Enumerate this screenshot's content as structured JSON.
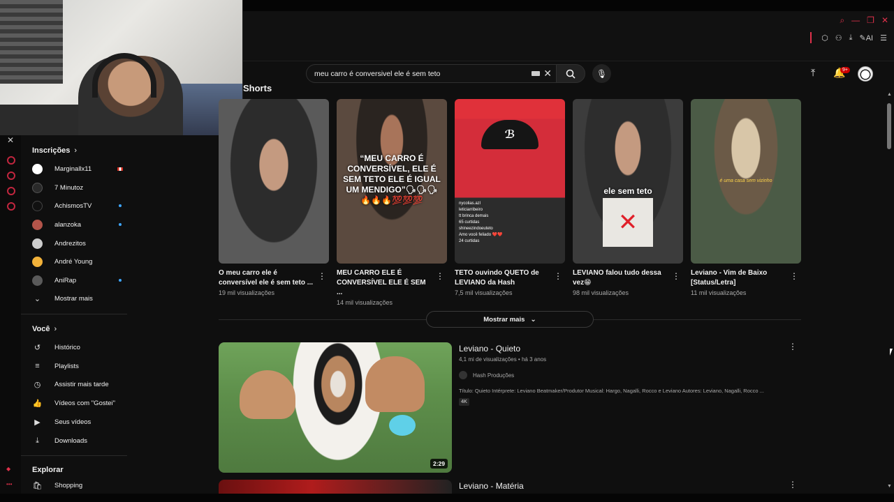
{
  "search": {
    "query": "meu carro é conversivel ele é sem teto",
    "clear_icon": "close-icon",
    "search_icon": "search-icon",
    "mic_icon": "mic-icon"
  },
  "header": {
    "notifications_badge": "9+",
    "upload_icon": "upload-icon",
    "bell_icon": "bell-icon"
  },
  "browser": {
    "ai_label": "AI"
  },
  "sidebar": {
    "subscriptions_heading": "Inscrições",
    "subscriptions": [
      {
        "name": "Marginallx11",
        "color": "#ffffff"
      },
      {
        "name": "7 Minutoz",
        "color": "#2a2a2a"
      },
      {
        "name": "AchismosTV",
        "color": "#111111"
      },
      {
        "name": "alanzoka",
        "color": "#b3544a"
      },
      {
        "name": "Andrezitos",
        "color": "#cccccc"
      },
      {
        "name": "André Young",
        "color": "#f2b23a"
      },
      {
        "name": "AniRap",
        "color": "#5a5a5a"
      }
    ],
    "show_more": "Mostrar mais",
    "you_heading": "Você",
    "you_items": [
      {
        "label": "Histórico",
        "icon": "history-icon"
      },
      {
        "label": "Playlists",
        "icon": "playlist-icon"
      },
      {
        "label": "Assistir mais tarde",
        "icon": "clock-icon"
      },
      {
        "label": "Vídeos com \"Gostei\"",
        "icon": "thumbs-up-icon"
      },
      {
        "label": "Seus vídeos",
        "icon": "video-icon"
      },
      {
        "label": "Downloads",
        "icon": "download-icon"
      }
    ],
    "explore_heading": "Explorar",
    "explore_items": [
      {
        "label": "Shopping",
        "icon": "shopping-bag-icon"
      }
    ]
  },
  "shorts": {
    "section_title": "Shorts",
    "items": [
      {
        "title": "O meu carro ele é conversível ele é sem teto ...",
        "views": "19 mil visualizações"
      },
      {
        "title": "MEU CARRO ELE É CONVERSÍVEL ELE É SEM ...",
        "views": "14 mil visualizações",
        "overlay": "“MEU CARRO É CONVERSÍVEL, ELE É SEM TETO ELE É IGUAL UM MENDIGO”🗣🗣🗣🔥🔥🔥💯💯💯"
      },
      {
        "title": "TETO ouvindo QUETO de LEVIANO da Hash",
        "views": "7,5 mil visualizações",
        "comments": [
          "nycolias.azl",
          "leticiarribeiro",
          "tt brinca demais",
          "65 curtidas",
          "shineezindoeuteto",
          "Amo você feliado ❤️❤️",
          "24 curtidas"
        ]
      },
      {
        "title": "LEVIANO falou tudo dessa vez😁",
        "views": "98 mil visualizações",
        "overlay": "ele sem teto"
      },
      {
        "title": "Leviano - Vim de Baixo [Status/Letra]",
        "views": "11 mil visualizações",
        "overlay": "é uma casa sem vizinho"
      }
    ],
    "show_more": "Mostrar mais"
  },
  "videos": [
    {
      "title": "Leviano - Quieto",
      "stats": "4,1 mi de visualizações • há 3 anos",
      "channel": "Hash Produções",
      "description": "Título: Quieto Intérprete: Leviano Beatmaker/Produtor Musical: Hargo, Nagalli, Rocco e Leviano Autores: Leviano, Nagalli, Rocco ...",
      "badge": "4K",
      "duration": "2:29"
    },
    {
      "title": "Leviano - Matéria"
    }
  ]
}
